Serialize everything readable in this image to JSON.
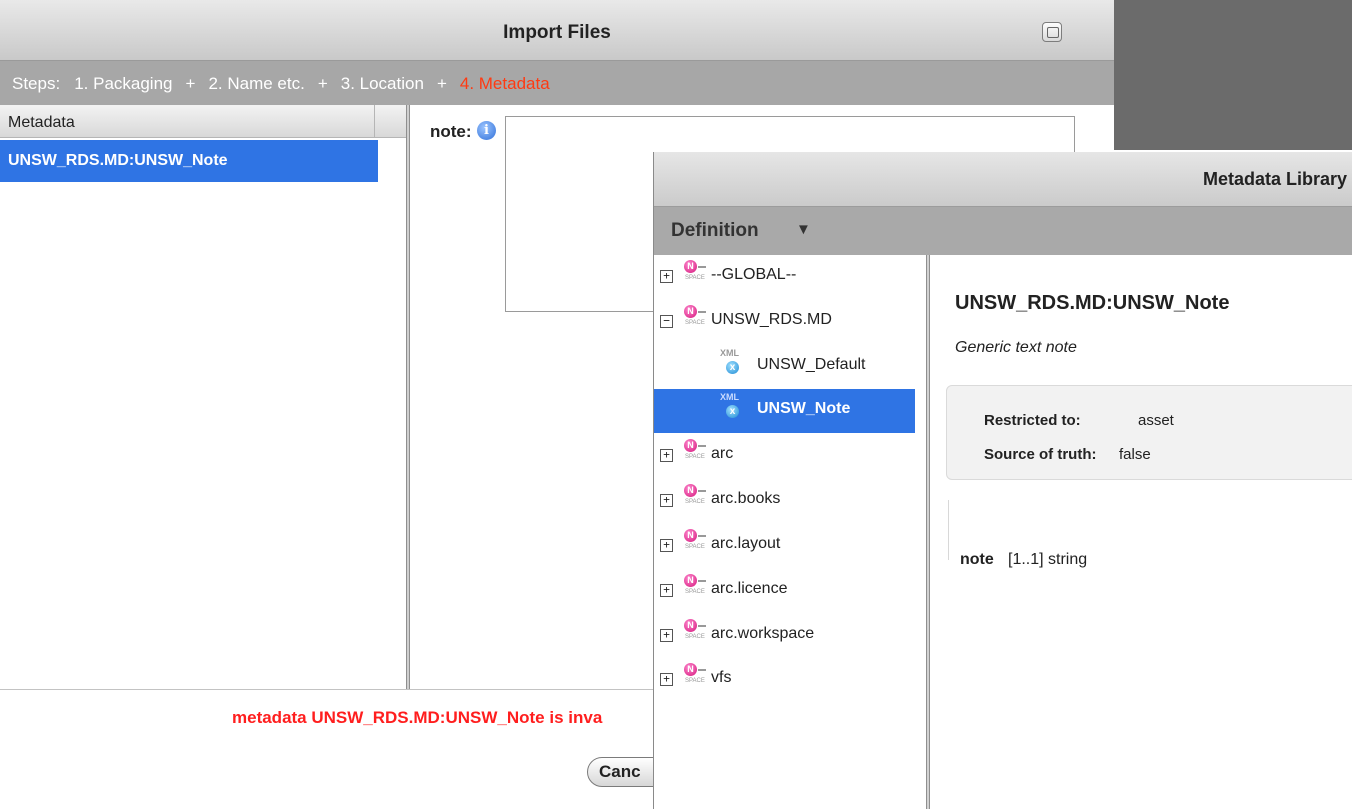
{
  "import_window": {
    "title": "Import Files",
    "steps": {
      "prefix": "Steps:",
      "items": [
        "1. Packaging",
        "2. Name etc.",
        "3. Location",
        "4. Metadata"
      ],
      "separator": "+",
      "active_index": 3
    },
    "metadata_list": {
      "header": "Metadata",
      "items": [
        "UNSW_RDS.MD:UNSW_Note"
      ],
      "selected_index": 0
    },
    "field": {
      "label": "note:",
      "value": ""
    },
    "error": "metadata UNSW_RDS.MD:UNSW_Note is inva",
    "cancel_label": "Canc"
  },
  "library_window": {
    "title": "Metadata Library",
    "definition_label": "Definition",
    "tree": [
      {
        "label": "--GLOBAL--",
        "type": "namespace",
        "expanded": false
      },
      {
        "label": "UNSW_RDS.MD",
        "type": "namespace",
        "expanded": true
      },
      {
        "label": "UNSW_Default",
        "type": "definition"
      },
      {
        "label": "UNSW_Note",
        "type": "definition",
        "selected": true
      },
      {
        "label": "arc",
        "type": "namespace",
        "expanded": false
      },
      {
        "label": "arc.books",
        "type": "namespace",
        "expanded": false
      },
      {
        "label": "arc.layout",
        "type": "namespace",
        "expanded": false
      },
      {
        "label": "arc.licence",
        "type": "namespace",
        "expanded": false
      },
      {
        "label": "arc.workspace",
        "type": "namespace",
        "expanded": false
      },
      {
        "label": "vfs",
        "type": "namespace",
        "expanded": false
      }
    ],
    "details": {
      "title": "UNSW_RDS.MD:UNSW_Note",
      "description": "Generic text note",
      "restricted_label": "Restricted to:",
      "restricted_value": "asset",
      "source_label": "Source of truth:",
      "source_value": "false",
      "element_name": "note",
      "element_spec": "[1..1] string"
    }
  },
  "colors": {
    "selection": "#2f74e4",
    "active_step": "#ff3a12",
    "error": "#ff1e1e",
    "namespace_icon": "#d4157a",
    "xml_icon": "#1f8bd4"
  },
  "icons": {
    "namespace": "namespace-icon",
    "definition": "xml-doc-icon",
    "info": "info-icon",
    "expand": "expand-icon",
    "collapse": "collapse-icon",
    "maximize": "maximize-icon",
    "dropdown": "caret-down-icon"
  }
}
